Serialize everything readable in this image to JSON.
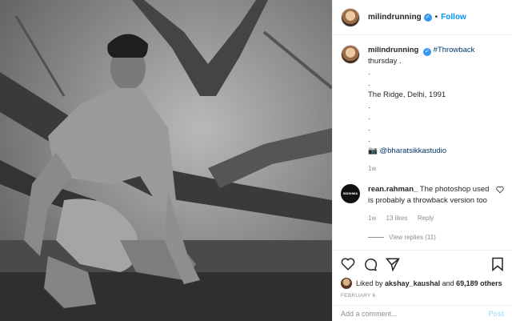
{
  "header": {
    "username": "milindrunning",
    "separator": "•",
    "follow_label": "Follow"
  },
  "caption": {
    "username": "milindrunning",
    "hashtag": "#Throwback",
    "lines": [
      "thursday .",
      ".",
      ".",
      "The Ridge, Delhi, 1991",
      ".",
      ".",
      ".",
      "."
    ],
    "credit": "@bharatsikkastudio",
    "camera_icon": "camera-icon",
    "age": "1w"
  },
  "comment": {
    "username": "rean.rahman_",
    "text": "The photoshop used is probably a throwback version too",
    "avatar_text": "SIDSHMA",
    "age": "1w",
    "likes": "13 likes",
    "reply_label": "Reply",
    "view_replies": "View replies (11)"
  },
  "likes": {
    "prefix": "Liked by",
    "user": "akshay_kaushal",
    "conjunction": "and",
    "count": "69,189 others"
  },
  "date": "FEBRUARY 6",
  "add_comment": {
    "placeholder": "Add a comment...",
    "post_label": "Post"
  },
  "colors": {
    "accent": "#0095f6",
    "verified": "#3897f0",
    "muted": "#8e8e8e"
  }
}
